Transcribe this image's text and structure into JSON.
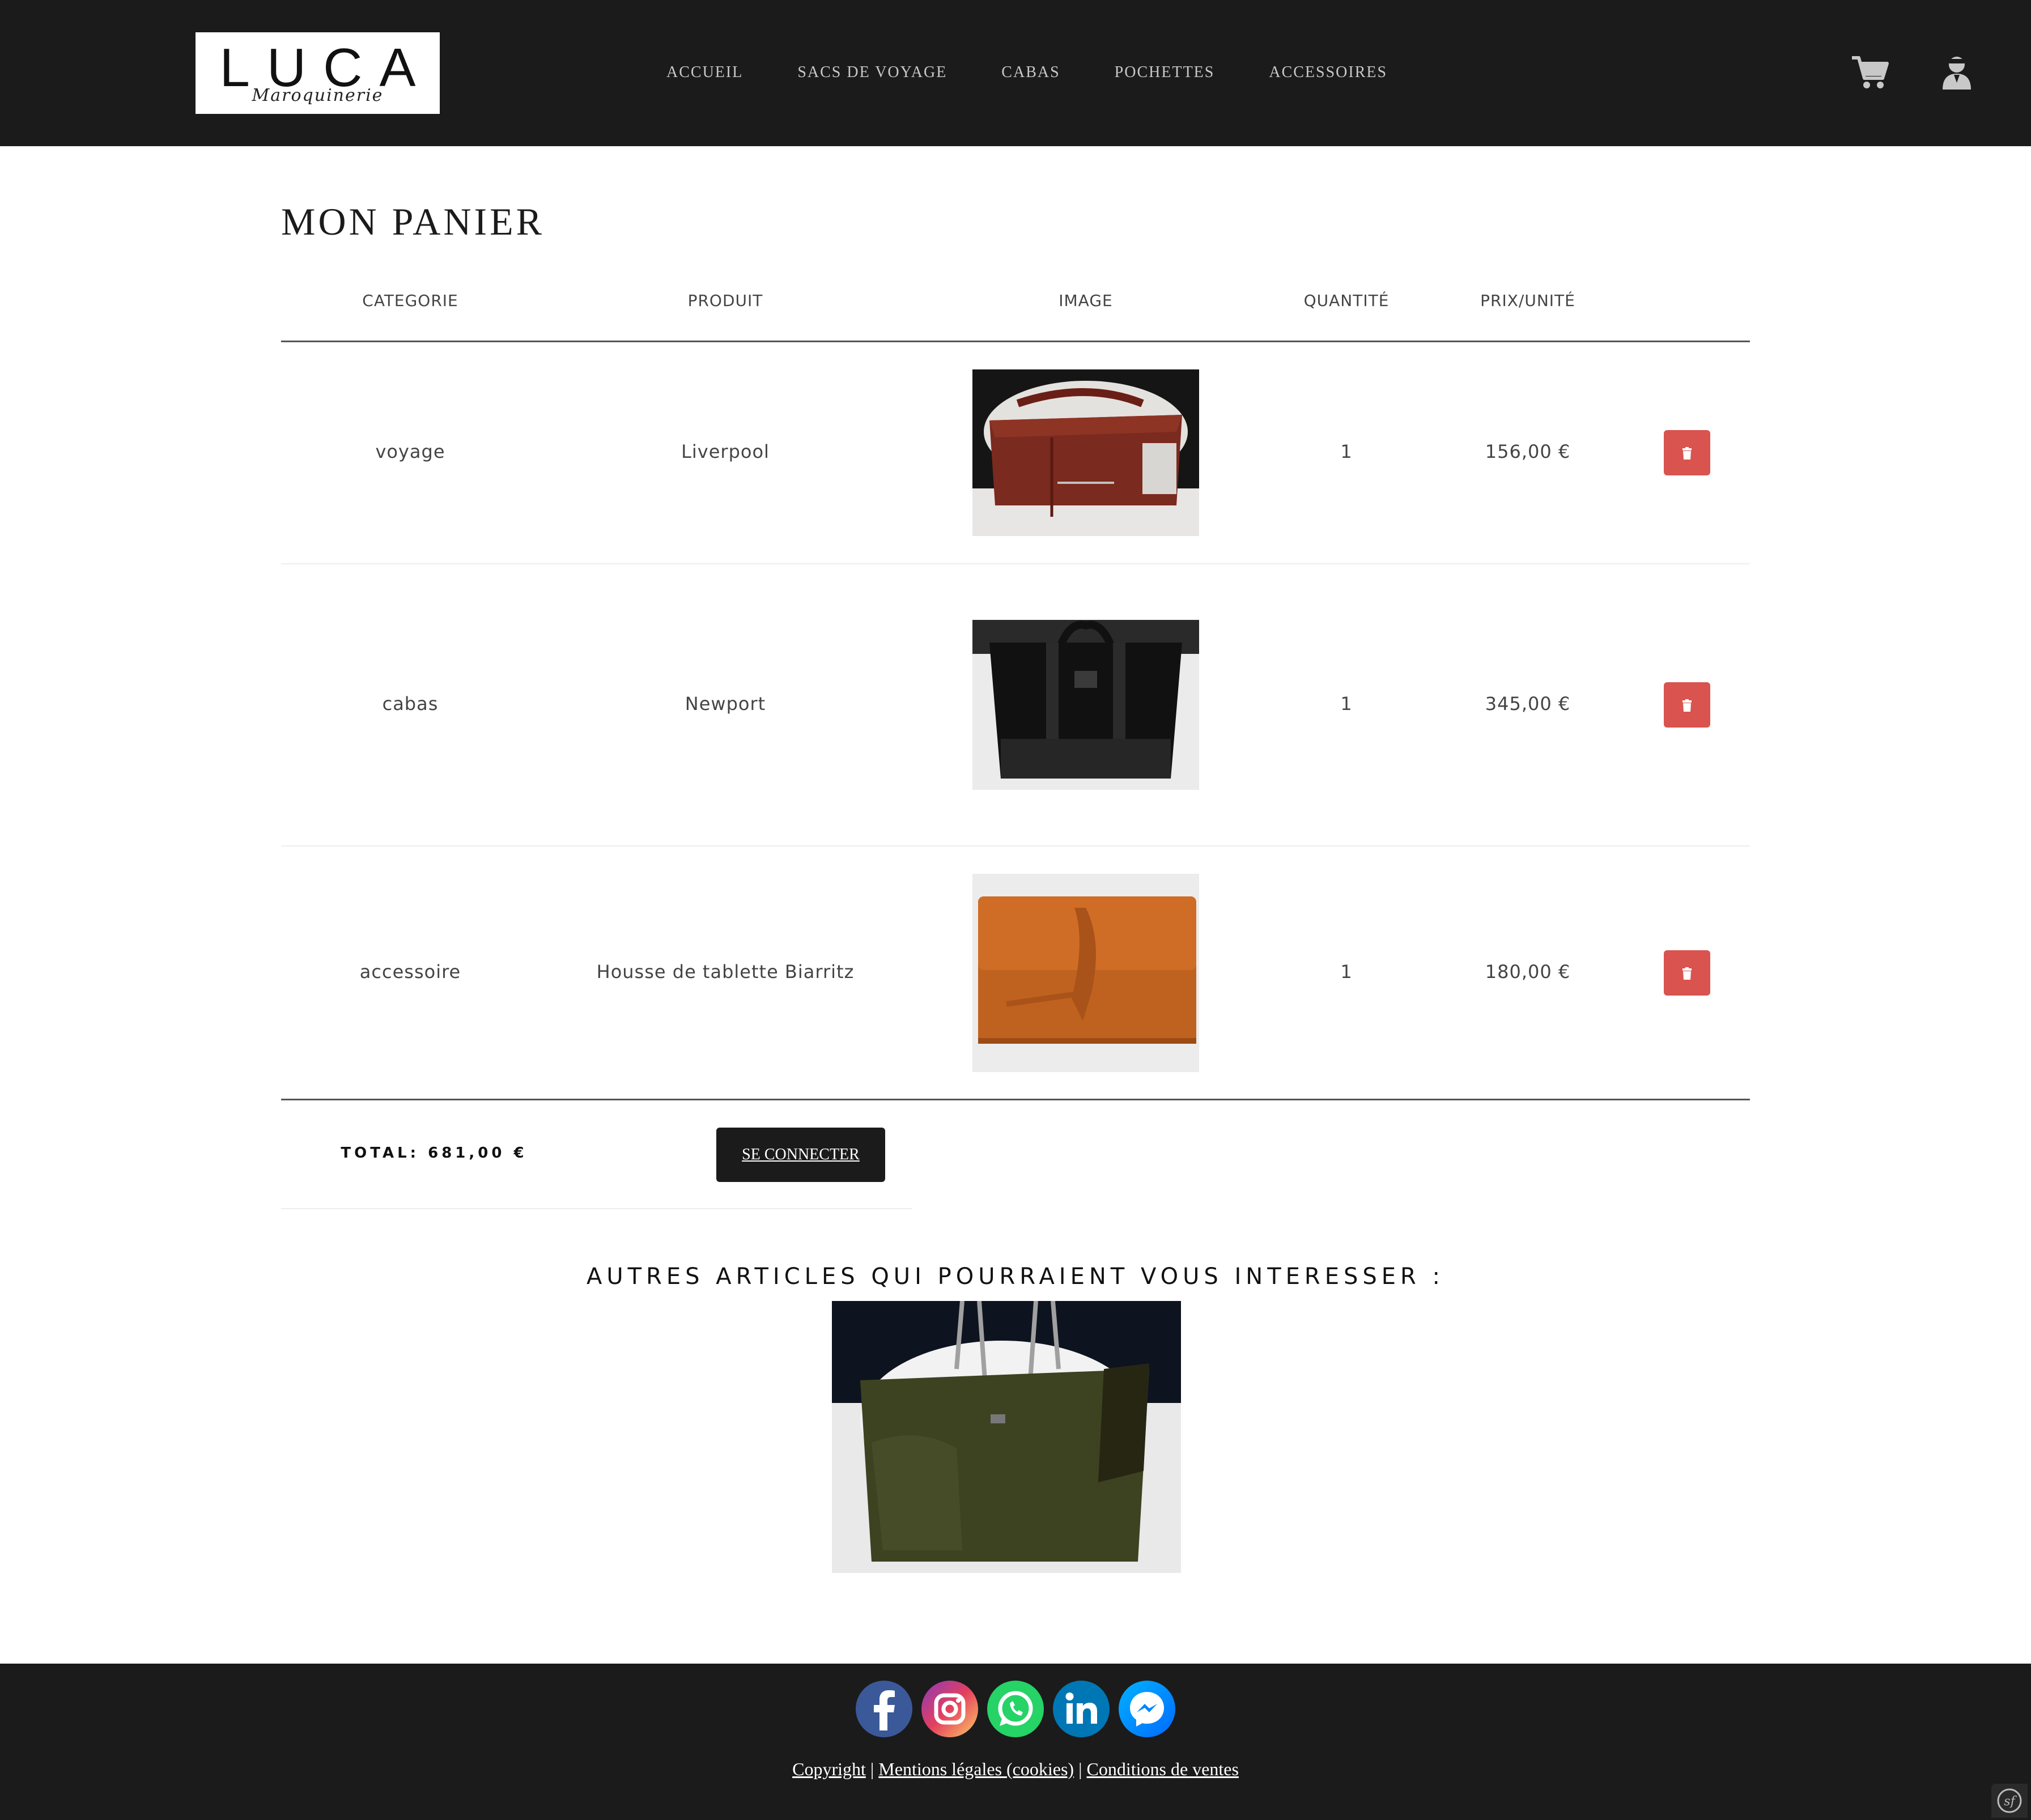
{
  "brand": {
    "name": "LUCA",
    "tagline": "Maroquinerie"
  },
  "nav": {
    "items": [
      "ACCUEIL",
      "SACS DE VOYAGE",
      "CABAS",
      "POCHETTES",
      "ACCESSOIRES"
    ],
    "cart_icon": "cart-icon",
    "user_icon": "user-icon"
  },
  "cart": {
    "title": "MON PANIER",
    "headers": {
      "category": "CATEGORIE",
      "product": "PRODUIT",
      "image": "IMAGE",
      "quantity": "QUANTITÉ",
      "price": "PRIX/UNITÉ"
    },
    "rows": [
      {
        "category": "voyage",
        "product": "Liverpool",
        "quantity": "1",
        "price": "156,00 €"
      },
      {
        "category": "cabas",
        "product": "Newport",
        "quantity": "1",
        "price": "345,00 €"
      },
      {
        "category": "accessoire",
        "product": "Housse de tablette Biarritz",
        "quantity": "1",
        "price": "180,00 €"
      }
    ],
    "total": "TOTAL: 681,00 €",
    "connect_button": "SE CONNECTER",
    "delete_icon": "trash-icon"
  },
  "recommendations": {
    "title": "AUTRES ARTICLES QUI POURRAIENT VOUS INTERESSER :"
  },
  "footer": {
    "socials": [
      "facebook",
      "instagram",
      "whatsapp",
      "linkedin",
      "messenger"
    ],
    "copyright": "Copyright",
    "legal": "Mentions légales (cookies)",
    "terms": "Conditions de ventes",
    "separator": "|"
  },
  "colors": {
    "header_bg": "#1b1b1b",
    "delete_red": "#d9534f"
  }
}
